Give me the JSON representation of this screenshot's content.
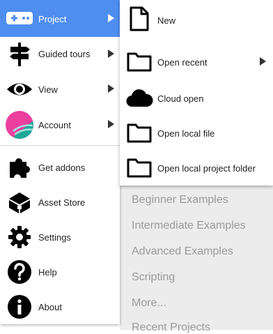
{
  "main_menu": {
    "items": [
      {
        "label": "Project",
        "icon": "gamepad-icon",
        "has_submenu": true,
        "active": true
      },
      {
        "label": "Guided tours",
        "icon": "signpost-icon",
        "has_submenu": true
      },
      {
        "label": "View",
        "icon": "eye-icon",
        "has_submenu": true
      },
      {
        "label": "Account",
        "icon": "avatar",
        "has_submenu": true
      },
      {
        "label": "Get addons",
        "icon": "puzzle-icon"
      },
      {
        "label": "Asset Store",
        "icon": "treasure-chest-icon"
      },
      {
        "label": "Settings",
        "icon": "gear-icon"
      },
      {
        "label": "Help",
        "icon": "question-icon"
      },
      {
        "label": "About",
        "icon": "info-icon"
      }
    ]
  },
  "project_submenu": {
    "items": [
      {
        "label": "New",
        "icon": "new-file-icon"
      },
      {
        "label": "Open recent",
        "icon": "folder-icon",
        "has_submenu": true
      },
      {
        "label": "Cloud open",
        "icon": "cloud-icon"
      },
      {
        "label": "Open local file",
        "icon": "folder-icon"
      },
      {
        "label": "Open local project folder",
        "icon": "folder-icon"
      }
    ]
  },
  "background_links": [
    "Beginner Examples",
    "Intermediate Examples",
    "Advanced Examples",
    "Scripting",
    "More...",
    "Recent Projects"
  ],
  "colors": {
    "active_bg": "#4e8ef1",
    "active_text": "#ffffff",
    "background_link": "#9a9a9a"
  }
}
